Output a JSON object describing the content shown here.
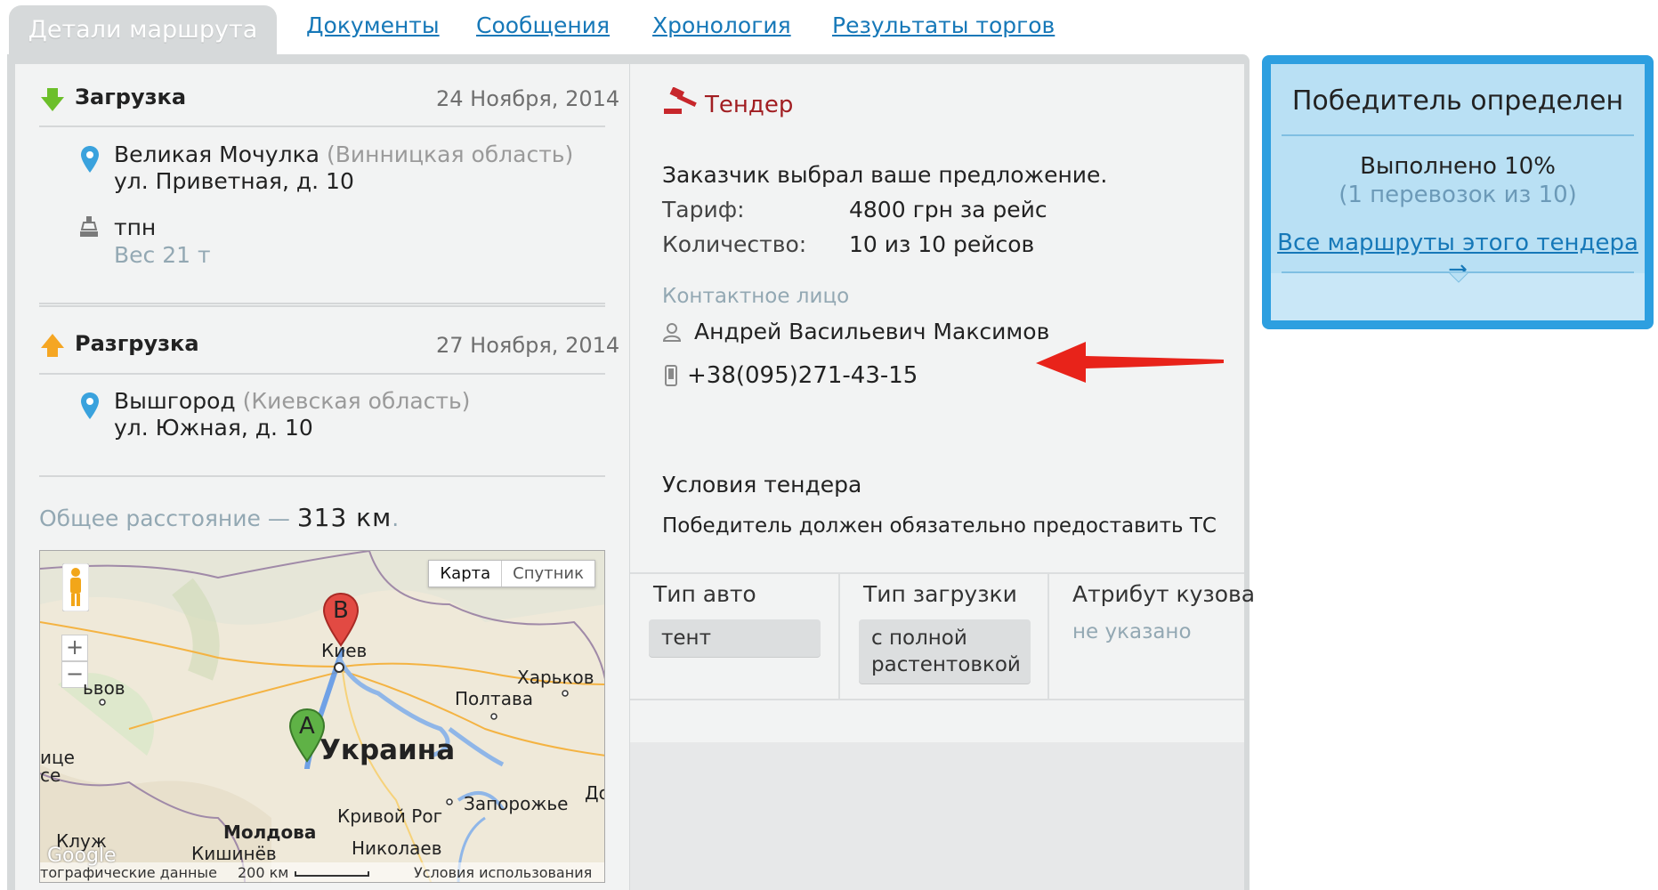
{
  "tabs": {
    "active": "Детали маршрута",
    "links": [
      "Документы",
      "Сообщения",
      "Хронология",
      "Результаты торгов"
    ]
  },
  "loading": {
    "title": "Загрузка",
    "date": "24 Ноября, 2014",
    "city": "Великая Мочулка",
    "region": "(Винницкая область)",
    "street": "ул. Приветная, д. 10",
    "cargo": "тпн",
    "weight": "Вес 21 т"
  },
  "unloading": {
    "title": "Разгрузка",
    "date": "27 Ноября, 2014",
    "city": "Вышгород",
    "region": "(Киевская область)",
    "street": "ул. Южная, д. 10"
  },
  "distance": {
    "label": "Общее расстояние —",
    "value": "313 км",
    "dot": "."
  },
  "map": {
    "btn_map": "Карта",
    "btn_satellite": "Спутник",
    "zoom_in": "+",
    "zoom_out": "−",
    "marker_a": "A",
    "marker_b": "B",
    "cities": {
      "kiev": "Киев",
      "kharkov": "Харьков",
      "poltava": "Полтава",
      "ukraine": "Украина",
      "lvov": "ьвов",
      "krivoy_rog": "Кривой Рог",
      "zaporozhe": "Запорожье",
      "do": "До",
      "moldova": "Молдова",
      "kishinev": "Кишинёв",
      "nikolaev": "Николаев",
      "cluj": "Клуж",
      "ice": "ице",
      "ce": "се"
    },
    "footer_data": "тографические данные",
    "scale": "200 км",
    "terms": "Условия использования",
    "google": "Google"
  },
  "tender": {
    "title": "Тендер",
    "intro": "Заказчик выбрал ваше предложение.",
    "tariff_label": "Тариф:",
    "tariff_value": "4800 грн за рейс",
    "qty_label": "Количество:",
    "qty_value": "10 из 10 рейсов",
    "contact_label": "Контактное лицо",
    "contact_name": "Андрей Васильевич Максимов",
    "contact_phone": "+38(095)271-43-15",
    "conditions_title": "Условия тендера",
    "conditions_text": "Победитель должен обязательно предоставить ТС"
  },
  "attributes": {
    "car_type_label": "Тип авто",
    "car_type_value": "тент",
    "load_type_label": "Тип загрузки",
    "load_type_value_1": "с полной",
    "load_type_value_2": "растентовкой",
    "body_attr_label": "Атрибут кузова",
    "body_attr_value": "не указано"
  },
  "status": {
    "title": "Победитель определен",
    "progress": "Выполнено 10%",
    "progress_detail": "(1 перевозок из 10)",
    "link": "Все маршруты этого тендера →"
  },
  "colors": {
    "accent_blue": "#2d9fe0",
    "link": "#1678b8",
    "tender_red": "#a11e22",
    "arrow_red": "#e8231a"
  }
}
